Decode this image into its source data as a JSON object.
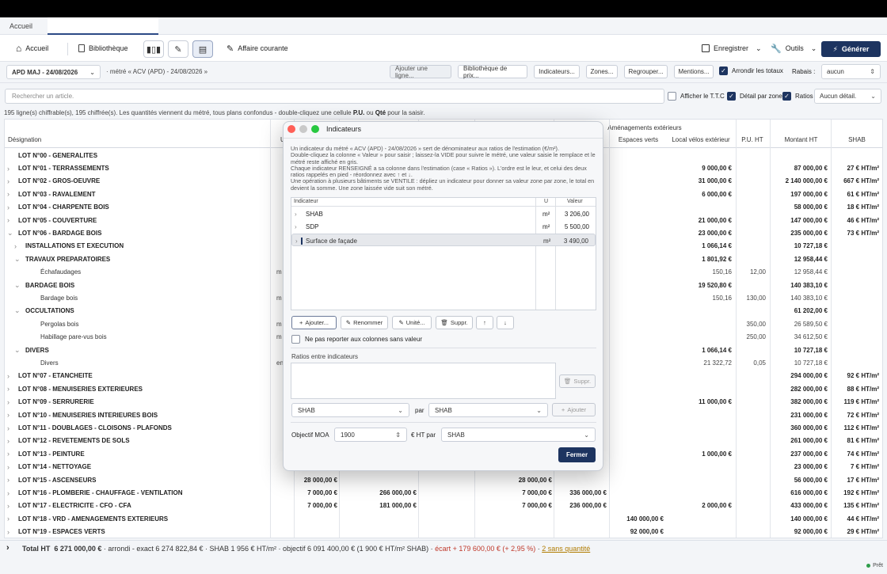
{
  "tabs": {
    "home": "Accueil"
  },
  "toolbar": {
    "accueil": "Accueil",
    "bibliotheque": "Bibliothèque",
    "affaire": "Affaire courante",
    "enregistrer": "Enregistrer",
    "outils": "Outils",
    "generer": "Générer"
  },
  "filterbar": {
    "version": "APD MAJ - 24/08/2026",
    "metre": "· métré « ACV (APD) - 24/08/2026 »",
    "btn_ajouter_ligne": "Ajouter une ligne...",
    "btn_bibliotheque_prix": "Bibliothèque de prix...",
    "btn_indicateurs": "Indicateurs...",
    "btn_zones": "Zones...",
    "btn_regrouper": "Regrouper...",
    "btn_mentions": "Mentions...",
    "arrondir": "Arrondir les totaux",
    "rabais_label": "Rabais :",
    "rabais_value": "aucun"
  },
  "searchrow": {
    "placeholder": "Rechercher un article.",
    "afficher_ttc": "Afficher le T.T.C",
    "detail_zone": "Détail par zone",
    "ratios": "Ratios",
    "aucun_detail": "Aucun détail."
  },
  "info": {
    "part1": "195 ligne(s) chiffrable(s), 195 chiffrée(s). Les quantités viennent du métré, tous plans confondus - double-cliquez une cellule ",
    "pu": "P.U.",
    "ou": " ou ",
    "qte": "Qté",
    "part2": " pour la saisir."
  },
  "grid": {
    "headers": {
      "designation": "Désignation",
      "unit": "U",
      "amenagements": "Aménagements extérieurs",
      "espaces_verts": "Espaces verts",
      "local_velos": "Local vélos extérieur",
      "pu_ht": "P.U. HT",
      "montant_ht": "Montant HT",
      "shab": "SHAB"
    },
    "rows": [
      {
        "label": "LOT N°00 - GENERALITES",
        "kind": "lot",
        "arrow": "",
        "unit": "",
        "c1": "",
        "c2": "",
        "c3": "",
        "c4": "",
        "ev": "",
        "lv": "",
        "pu": "",
        "mt": "",
        "sh": ""
      },
      {
        "label": "LOT N°01 - TERRASSEMENTS",
        "kind": "lot",
        "arrow": "›",
        "unit": "",
        "c1": "",
        "c2": "",
        "c3": "",
        "c4": "",
        "ev": "",
        "lv": "9 000,00 €",
        "pu": "",
        "mt": "87 000,00 €",
        "sh": "27 € HT/m²"
      },
      {
        "label": "LOT N°02 - GROS-OEUVRE",
        "kind": "lot",
        "arrow": "›",
        "unit": "",
        "c1": "",
        "c2": "",
        "c3": "",
        "c4": "",
        "ev": "",
        "lv": "31 000,00 €",
        "pu": "",
        "mt": "2 140 000,00 €",
        "sh": "667 € HT/m²"
      },
      {
        "label": "LOT N°03 - RAVALEMENT",
        "kind": "lot",
        "arrow": "›",
        "unit": "",
        "c1": "",
        "c2": "",
        "c3": "",
        "c4": "",
        "ev": "",
        "lv": "6 000,00 €",
        "pu": "",
        "mt": "197 000,00 €",
        "sh": "61 € HT/m²"
      },
      {
        "label": "LOT N°04 - CHARPENTE BOIS",
        "kind": "lot",
        "arrow": "›",
        "unit": "",
        "c1": "",
        "c2": "",
        "c3": "",
        "c4": "",
        "ev": "",
        "lv": "",
        "pu": "",
        "mt": "58 000,00 €",
        "sh": "18 € HT/m²"
      },
      {
        "label": "LOT N°05 - COUVERTURE",
        "kind": "lot",
        "arrow": "›",
        "unit": "",
        "c1": "",
        "c2": "",
        "c3": "",
        "c4": "",
        "ev": "",
        "lv": "21 000,00 €",
        "pu": "",
        "mt": "147 000,00 €",
        "sh": "46 € HT/m²"
      },
      {
        "label": "LOT N°06 - BARDAGE BOIS",
        "kind": "lot",
        "arrow": "⌄",
        "unit": "",
        "c1": "",
        "c2": "",
        "c3": "",
        "c4": "",
        "ev": "",
        "lv": "23 000,00 €",
        "pu": "",
        "mt": "235 000,00 €",
        "sh": "73 € HT/m²"
      },
      {
        "label": "INSTALLATIONS ET EXECUTION",
        "kind": "sub",
        "arrow": "›",
        "unit": "",
        "c1": "",
        "c2": "",
        "c3": "",
        "c4": "",
        "ev": "",
        "lv": "1 066,14 €",
        "pu": "",
        "mt": "10 727,18 €",
        "sh": ""
      },
      {
        "label": "TRAVAUX PREPARATOIRES",
        "kind": "sub",
        "arrow": "⌄",
        "unit": "",
        "c1": "",
        "c2": "",
        "c3": "",
        "c4": "",
        "ev": "",
        "lv": "1 801,92 €",
        "pu": "",
        "mt": "12 958,44 €",
        "sh": ""
      },
      {
        "label": "Échafaudages",
        "kind": "item",
        "arrow": "",
        "unit": "m",
        "c1": "",
        "c2": "",
        "c3": "",
        "c4": "",
        "ev": "",
        "lv": "150,16",
        "pu": "12,00",
        "mt": "12 958,44 €",
        "sh": ""
      },
      {
        "label": "BARDAGE BOIS",
        "kind": "sub",
        "arrow": "⌄",
        "unit": "",
        "c1": "",
        "c2": "",
        "c3": "",
        "c4": "",
        "ev": "",
        "lv": "19 520,80 €",
        "pu": "",
        "mt": "140 383,10 €",
        "sh": ""
      },
      {
        "label": "Bardage bois",
        "kind": "item",
        "arrow": "",
        "unit": "m",
        "c1": "",
        "c2": "",
        "c3": "",
        "c4": "",
        "ev": "",
        "lv": "150,16",
        "pu": "130,00",
        "mt": "140 383,10 €",
        "sh": ""
      },
      {
        "label": "OCCULTATIONS",
        "kind": "sub",
        "arrow": "⌄",
        "unit": "",
        "c1": "",
        "c2": "",
        "c3": "",
        "c4": "",
        "ev": "",
        "lv": "",
        "pu": "",
        "mt": "61 202,00 €",
        "sh": ""
      },
      {
        "label": "Pergolas bois",
        "kind": "item",
        "arrow": "",
        "unit": "m",
        "c1": "",
        "c2": "",
        "c3": "",
        "c4": "",
        "ev": "",
        "lv": "",
        "pu": "350,00",
        "mt": "26 589,50 €",
        "sh": ""
      },
      {
        "label": "Habillage pare-vus bois",
        "kind": "item",
        "arrow": "",
        "unit": "m",
        "c1": "",
        "c2": "",
        "c3": "",
        "c4": "",
        "ev": "",
        "lv": "",
        "pu": "250,00",
        "mt": "34 612,50 €",
        "sh": ""
      },
      {
        "label": "DIVERS",
        "kind": "sub",
        "arrow": "⌄",
        "unit": "",
        "c1": "",
        "c2": "",
        "c3": "",
        "c4": "",
        "ev": "",
        "lv": "1 066,14 €",
        "pu": "",
        "mt": "10 727,18 €",
        "sh": ""
      },
      {
        "label": "Divers",
        "kind": "item",
        "arrow": "",
        "unit": "en",
        "c1": "",
        "c2": "",
        "c3": "",
        "c4": "",
        "ev": "",
        "lv": "21 322,72",
        "pu": "0,05",
        "mt": "10 727,18 €",
        "sh": ""
      },
      {
        "label": "LOT N°07 - ETANCHEITE",
        "kind": "lot",
        "arrow": "›",
        "unit": "",
        "c1": "",
        "c2": "",
        "c3": "",
        "c4": "",
        "ev": "",
        "lv": "",
        "pu": "",
        "mt": "294 000,00 €",
        "sh": "92 € HT/m²"
      },
      {
        "label": "LOT N°08 - MENUISERIES EXTERIEURES",
        "kind": "lot",
        "arrow": "›",
        "unit": "",
        "c1": "",
        "c2": "",
        "c3": "",
        "c4": "",
        "ev": "",
        "lv": "",
        "pu": "",
        "mt": "282 000,00 €",
        "sh": "88 € HT/m²"
      },
      {
        "label": "LOT N°09 - SERRURERIE",
        "kind": "lot",
        "arrow": "›",
        "unit": "",
        "c1": "",
        "c2": "",
        "c3": "",
        "c4": "",
        "ev": "",
        "lv": "11 000,00 €",
        "pu": "",
        "mt": "382 000,00 €",
        "sh": "119 € HT/m²"
      },
      {
        "label": "LOT N°10 - MENUISERIES INTERIEURES BOIS",
        "kind": "lot",
        "arrow": "›",
        "unit": "",
        "c1": "",
        "c2": "",
        "c3": "",
        "c4": "",
        "ev": "",
        "lv": "",
        "pu": "",
        "mt": "231 000,00 €",
        "sh": "72 € HT/m²"
      },
      {
        "label": "LOT N°11 - DOUBLAGES - CLOISONS - PLAFONDS",
        "kind": "lot",
        "arrow": "›",
        "unit": "",
        "c1": "",
        "c2": "",
        "c3": "",
        "c4": "",
        "ev": "",
        "lv": "",
        "pu": "",
        "mt": "360 000,00 €",
        "sh": "112 € HT/m²"
      },
      {
        "label": "LOT N°12 - REVETEMENTS DE SOLS",
        "kind": "lot",
        "arrow": "›",
        "unit": "",
        "c1": "",
        "c2": "",
        "c3": "",
        "c4": "",
        "ev": "",
        "lv": "",
        "pu": "",
        "mt": "261 000,00 €",
        "sh": "81 € HT/m²"
      },
      {
        "label": "LOT N°13 - PEINTURE",
        "kind": "lot",
        "arrow": "›",
        "unit": "",
        "c1": "",
        "c2": "",
        "c3": "",
        "c4": "",
        "ev": "",
        "lv": "1 000,00 €",
        "pu": "",
        "mt": "237 000,00 €",
        "sh": "74 € HT/m²"
      },
      {
        "label": "LOT N°14 - NETTOYAGE",
        "kind": "lot",
        "arrow": "›",
        "unit": "",
        "c1": "",
        "c2": "",
        "c3": "",
        "c4": "",
        "ev": "",
        "lv": "",
        "pu": "",
        "mt": "23 000,00 €",
        "sh": "7 € HT/m²"
      },
      {
        "label": "LOT N°15 - ASCENSEURS",
        "kind": "lot",
        "arrow": "›",
        "unit": "",
        "c1": "28 000,00 €",
        "c2": "",
        "c3": "28 000,00 €",
        "c4": "",
        "ev": "",
        "lv": "",
        "pu": "",
        "mt": "56 000,00 €",
        "sh": "17 € HT/m²"
      },
      {
        "label": "LOT N°16 - PLOMBERIE - CHAUFFAGE - VENTILATION",
        "kind": "lot",
        "arrow": "›",
        "unit": "",
        "c1": "7 000,00 €",
        "c2": "266 000,00 €",
        "c3": "7 000,00 €",
        "c4": "336 000,00 €",
        "ev": "",
        "lv": "",
        "pu": "",
        "mt": "616 000,00 €",
        "sh": "192 € HT/m²"
      },
      {
        "label": "LOT N°17 - ELECTRICITE - CFO - CFA",
        "kind": "lot",
        "arrow": "›",
        "unit": "",
        "c1": "7 000,00 €",
        "c2": "181 000,00 €",
        "c3": "7 000,00 €",
        "c4": "236 000,00 €",
        "ev": "",
        "lv": "2 000,00 €",
        "pu": "",
        "mt": "433 000,00 €",
        "sh": "135 € HT/m²"
      },
      {
        "label": "LOT N°18 - VRD - AMENAGEMENTS EXTERIEURS",
        "kind": "lot",
        "arrow": "›",
        "unit": "",
        "c1": "",
        "c2": "",
        "c3": "",
        "c4": "",
        "ev": "140 000,00 €",
        "lv": "",
        "pu": "",
        "mt": "140 000,00 €",
        "sh": "44 € HT/m²"
      },
      {
        "label": "LOT N°19 - ESPACES VERTS",
        "kind": "lot",
        "arrow": "›",
        "unit": "",
        "c1": "",
        "c2": "",
        "c3": "",
        "c4": "",
        "ev": "92 000,00 €",
        "lv": "",
        "pu": "",
        "mt": "92 000,00 €",
        "sh": "29 € HT/m²"
      }
    ]
  },
  "footer": {
    "label": "Total HT",
    "total": "6 271 000,00 €",
    "mid": " · arrondi - exact 6 274 822,84 € · SHAB 1 956 € HT/m² · objectif 6 091 400,00 € (1 900 € HT/m² SHAB) · ",
    "ecart": "écart + 179 600,00 € (+ 2,95 %)",
    "sep": " · ",
    "sans_qte": "2 sans quantité",
    "status": "Prêt"
  },
  "modal": {
    "title": "Indicateurs",
    "desc": [
      "Un indicateur du métré « ACV (APD) - 24/08/2026 » sert de dénominateur aux ratios de l'estimation (€/m²).",
      "Double-cliquez la colonne « Valeur » pour saisir ; laissez-la VIDE pour suivre le métré, une valeur saisie le remplace et le métré reste affiché en gris.",
      "Chaque indicateur RENSEIGNÉ a sa colonne dans l'estimation (case « Ratios »). L'ordre est le leur, et celui des deux ratios rappelés en pied - réordonnez avec ↑ et ↓.",
      "Une opération à plusieurs bâtiments se VENTILE : dépliez un indicateur pour donner sa valeur zone par zone, le total en devient la somme. Une zone laissée vide suit son métré."
    ],
    "th_indicateur": "Indicateur",
    "th_u": "U",
    "th_valeur": "Valeur",
    "indicators": [
      {
        "name": "SHAB",
        "unit": "m²",
        "value": "3 206,00"
      },
      {
        "name": "SDP",
        "unit": "m²",
        "value": "5 500,00"
      },
      {
        "name": "Surface de façade",
        "unit": "m²",
        "value": "3 490,00"
      }
    ],
    "btn_ajouter": "Ajouter...",
    "btn_renommer": "Renommer",
    "btn_unite": "Unité...",
    "btn_suppr": "Suppr.",
    "up": "↑",
    "down": "↓",
    "ne_pas_reporter": "Ne pas reporter aux colonnes sans valeur",
    "ratios_label": "Ratios entre indicateurs",
    "btn_suppr2": "Suppr.",
    "ratio_sel1": "SHAB",
    "par": "par",
    "ratio_sel2": "SHAB",
    "btn_ajouter2": "Ajouter",
    "objectif_label": "Objectif MOA",
    "objectif_value": "1900",
    "eur_ht_par": "€ HT par",
    "objectif_sel": "SHAB",
    "btn_fermer": "Fermer"
  }
}
